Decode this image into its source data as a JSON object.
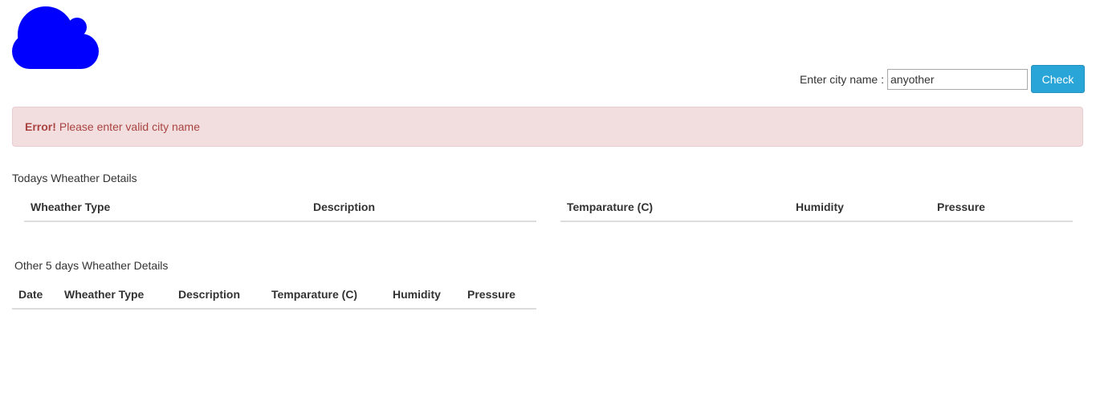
{
  "search": {
    "label": "Enter city name :",
    "value": "anyother",
    "button": "Check"
  },
  "alert": {
    "strong": "Error!",
    "message": "Please enter valid city name"
  },
  "today": {
    "title": "Todays Wheather Details",
    "left_headers": [
      "Wheather Type",
      "Description"
    ],
    "right_headers": [
      "Temparature (C)",
      "Humidity",
      "Pressure"
    ]
  },
  "forecast": {
    "title": "Other 5 days Wheather Details",
    "headers": [
      "Date",
      "Wheather Type",
      "Description",
      "Temparature (C)",
      "Humidity",
      "Pressure"
    ]
  },
  "colors": {
    "logo": "#0000ff",
    "button": "#2aa5d8",
    "alert_bg": "#f2dede",
    "alert_text": "#a94442"
  },
  "icons": {
    "logo": "cloud-icon"
  }
}
